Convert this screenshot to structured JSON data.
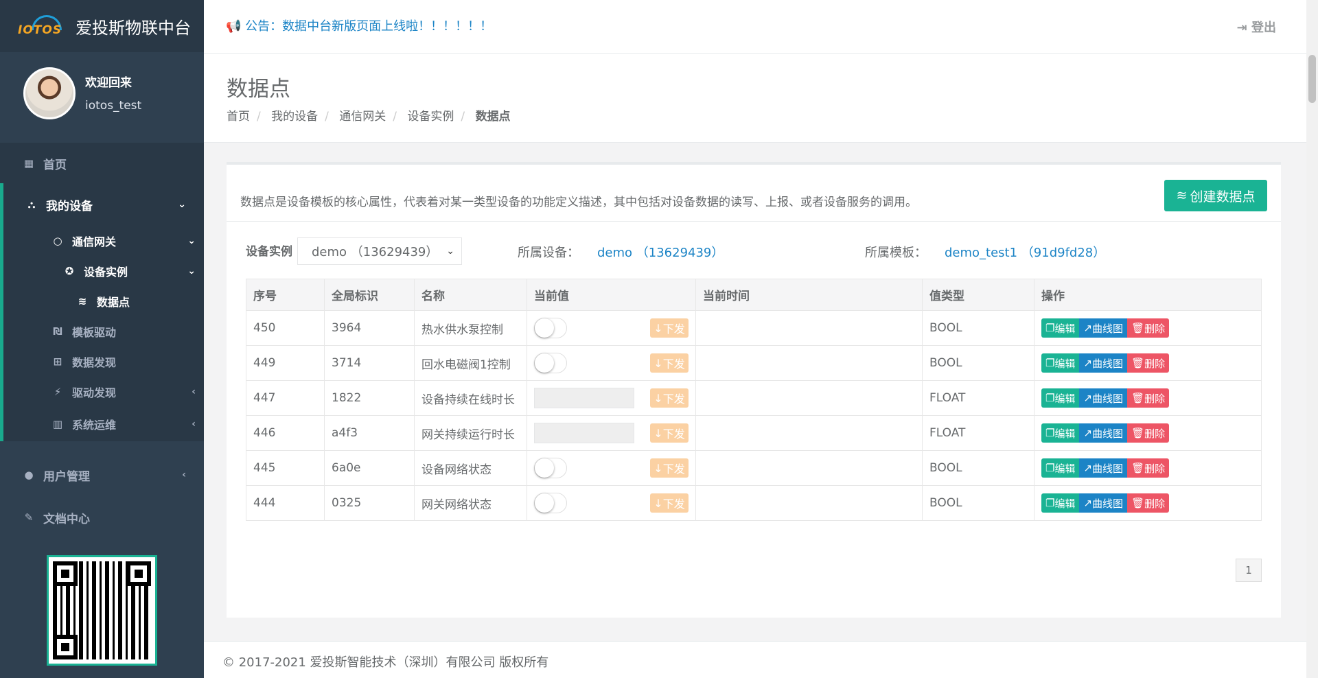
{
  "brand": {
    "logo_text": "IOTOS",
    "title": "爱投斯物联中台"
  },
  "profile": {
    "welcome": "欢迎回来",
    "username": "iotos_test"
  },
  "nav": {
    "home": "首页",
    "my_devices": "我的设备",
    "gateway": "通信网关",
    "device_instance": "设备实例",
    "data_points": "数据点",
    "template_driver": "模板驱动",
    "data_discovery": "数据发现",
    "driver_discovery": "驱动发现",
    "system_ops": "系统运维",
    "user_mgmt": "用户管理",
    "docs": "文档中心"
  },
  "topbar": {
    "notice": "公告：数据中台新版页面上线啦！！！！！！",
    "logout": "登出"
  },
  "heading": {
    "title": "数据点",
    "breadcrumb": [
      "首页",
      "我的设备",
      "通信网关",
      "设备实例",
      "数据点"
    ]
  },
  "panel": {
    "description": "数据点是设备模板的核心属性，代表着对某一类型设备的功能定义描述，其中包括对设备数据的读写、上报、或者设备服务的调用。",
    "create_button": "创建数据点",
    "filter_label": "设备实例",
    "filter_value": "demo （13629439）",
    "device_label": "所属设备：",
    "device_value": "demo （13629439）",
    "template_label": "所属模板：",
    "template_value": "demo_test1 （91d9fd28）"
  },
  "table": {
    "headers": [
      "序号",
      "全局标识",
      "名称",
      "当前值",
      "当前时间",
      "值类型",
      "操作"
    ],
    "send_label": "下发",
    "edit_label": "编辑",
    "chart_label": "曲线图",
    "delete_label": "删除",
    "rows": [
      {
        "id": "450",
        "gid": "3964",
        "name": "热水供水泵控制",
        "input": "toggle",
        "time": "",
        "type": "BOOL"
      },
      {
        "id": "449",
        "gid": "3714",
        "name": "回水电磁阀1控制",
        "input": "toggle",
        "time": "",
        "type": "BOOL"
      },
      {
        "id": "447",
        "gid": "1822",
        "name": "设备持续在线时长",
        "input": "number",
        "time": "",
        "type": "FLOAT"
      },
      {
        "id": "446",
        "gid": "a4f3",
        "name": "网关持续运行时长",
        "input": "number",
        "time": "",
        "type": "FLOAT"
      },
      {
        "id": "445",
        "gid": "6a0e",
        "name": "设备网络状态",
        "input": "toggle",
        "time": "",
        "type": "BOOL"
      },
      {
        "id": "444",
        "gid": "0325",
        "name": "网关网络状态",
        "input": "toggle",
        "time": "",
        "type": "BOOL"
      }
    ]
  },
  "pager": {
    "current": "1"
  },
  "footer": {
    "copyright": "© 2017-2021 爱投斯智能技术（深圳）有限公司 版权所有"
  },
  "colors": {
    "primary": "#1ab394",
    "info": "#1c84c6",
    "danger": "#ed5565",
    "warning": "#f8ac59",
    "sidebar": "#2f4050"
  }
}
